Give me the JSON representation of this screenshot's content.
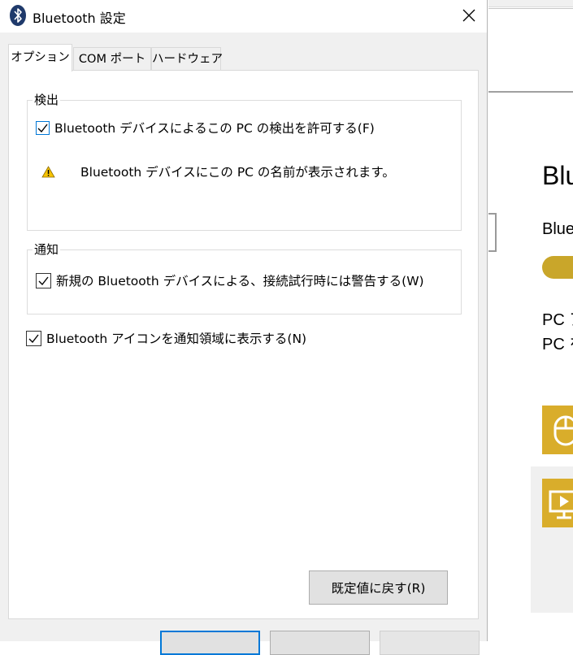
{
  "dialog": {
    "title": "Bluetooth 設定",
    "tabs": [
      {
        "label": "オプション",
        "active": true
      },
      {
        "label": "COM ポート",
        "active": false
      },
      {
        "label": "ハードウェア",
        "active": false
      }
    ],
    "discovery": {
      "group_title": "検出",
      "allow_discovery_label": "Bluetooth デバイスによるこの PC の検出を許可する(F)",
      "allow_discovery_checked": true,
      "warning_text": "Bluetooth デバイスにこの PC の名前が表示されます。"
    },
    "notifications": {
      "group_title": "通知",
      "alert_new_device_label": "新規の Bluetooth デバイスによる、接続試行時には警告する(W)",
      "alert_new_device_checked": true
    },
    "show_icon_label": "Bluetooth アイコンを通知領域に表示する(N)",
    "show_icon_checked": true,
    "restore_defaults_label": "既定値に戻す(R)"
  },
  "background_window": {
    "title_fragment": "Blu",
    "label_fragment": "Blue",
    "line1_fragment": "PC ア",
    "line2_fragment": "PC を",
    "accent_color": "#d9ad2b"
  }
}
